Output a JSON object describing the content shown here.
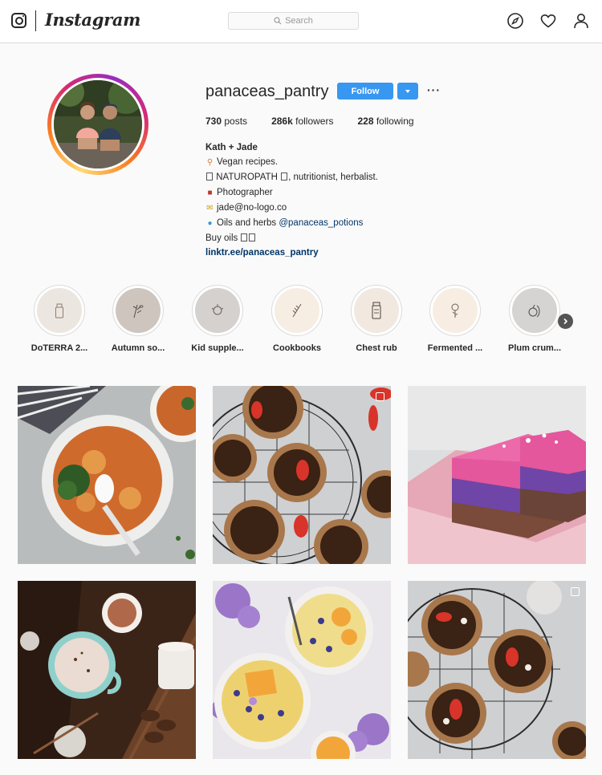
{
  "nav": {
    "logo_text": "Instagram",
    "search_placeholder": "Search",
    "icons": [
      "instagram-glyph-icon",
      "search-icon",
      "compass-icon",
      "heart-icon",
      "profile-icon"
    ]
  },
  "profile": {
    "username": "panaceas_pantry",
    "follow_label": "Follow",
    "more_label": "···",
    "stats": {
      "posts_count": "730",
      "posts_label": "posts",
      "followers_count": "286k",
      "followers_label": "followers",
      "following_count": "228",
      "following_label": "following"
    },
    "bio": {
      "name": "Kath + Jade",
      "line1": "Vegan recipes.",
      "line2": "NATUROPATH",
      "line2_after": ", nutritionist, herbalist.",
      "line3": "Photographer",
      "line4": "jade@no-logo.co",
      "line5": "Oils and herbs",
      "line5_mention": "@panaceas_potions",
      "line6": "Buy oils",
      "link": "linktr.ee/panaceas_pantry"
    }
  },
  "highlights": [
    {
      "label": "DoTERRA 2...",
      "bg": "#ece6e0"
    },
    {
      "label": "Autumn so...",
      "bg": "#cdc5be"
    },
    {
      "label": "Kid supple...",
      "bg": "#d5d1cf"
    },
    {
      "label": "Cookbooks",
      "bg": "#f6ede3"
    },
    {
      "label": "Chest rub",
      "bg": "#f1e8e0"
    },
    {
      "label": "Fermented ...",
      "bg": "#f7ede3"
    },
    {
      "label": "Plum crum...",
      "bg": "#d6d4d2"
    }
  ],
  "colors": {
    "accent": "#3897f0",
    "link": "#003569",
    "text": "#262626",
    "border": "#dbdbdb",
    "background": "#fafafa"
  },
  "posts": [
    {
      "name": "post-curry-bowl",
      "multi": false
    },
    {
      "name": "post-chocolate-tarts",
      "multi": true
    },
    {
      "name": "post-pink-slice",
      "multi": false
    },
    {
      "name": "post-hot-chocolate",
      "multi": false
    },
    {
      "name": "post-smoothie-bowls",
      "multi": false
    },
    {
      "name": "post-strawberry-tarts",
      "multi": true
    }
  ]
}
